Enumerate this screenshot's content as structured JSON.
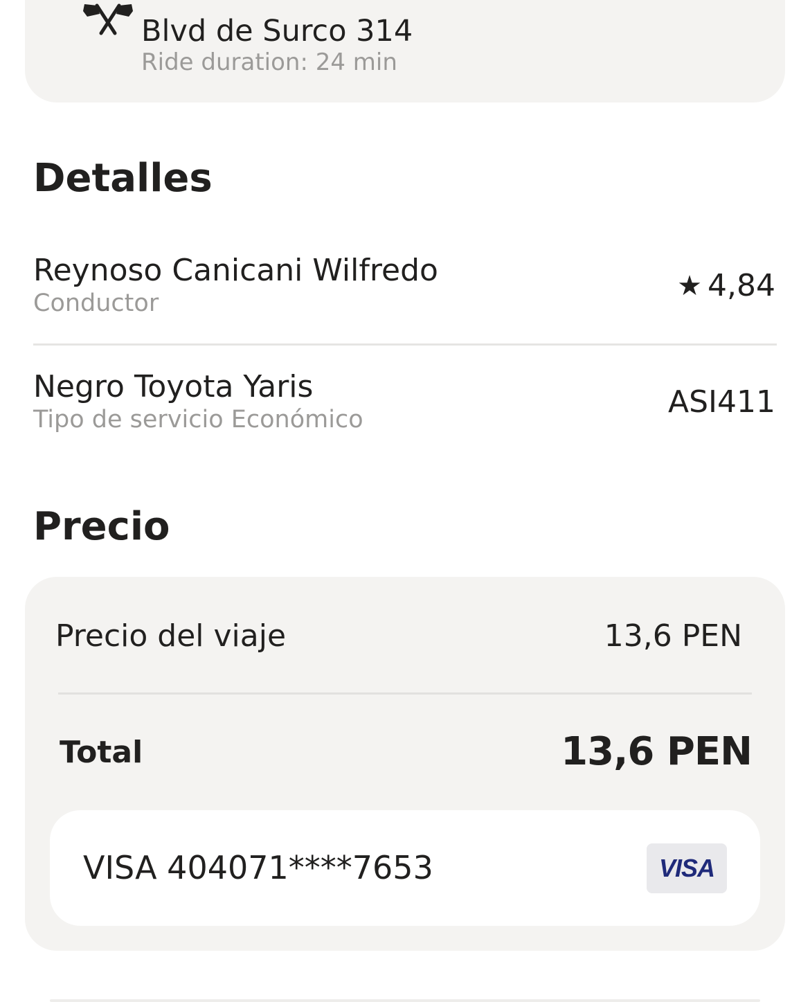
{
  "destination": {
    "icon": "finish-flags-icon",
    "address": "Blvd de Surco 314",
    "duration": "Ride duration: 24 min"
  },
  "details": {
    "title": "Detalles",
    "driver": {
      "name": "Reynoso Canicani Wilfredo",
      "role": "Conductor",
      "rating_icon": "star-icon",
      "rating": "4,84"
    },
    "car": {
      "model": "Negro Toyota Yaris",
      "service": "Tipo de servicio Económico",
      "plate": "ASI411"
    }
  },
  "price": {
    "title": "Precio",
    "trip_label": "Precio del viaje",
    "trip_value": "13,6 PEN",
    "total_label": "Total",
    "total_value": "13,6 PEN",
    "payment": {
      "label": "VISA 404071****7653",
      "brand": "VISA",
      "brand_icon": "visa-card-icon"
    }
  },
  "colors": {
    "card_bg": "#f4f3f1",
    "text_primary": "#21201f",
    "text_secondary": "#9b9a98",
    "visa_blue": "#1f2a7a"
  }
}
